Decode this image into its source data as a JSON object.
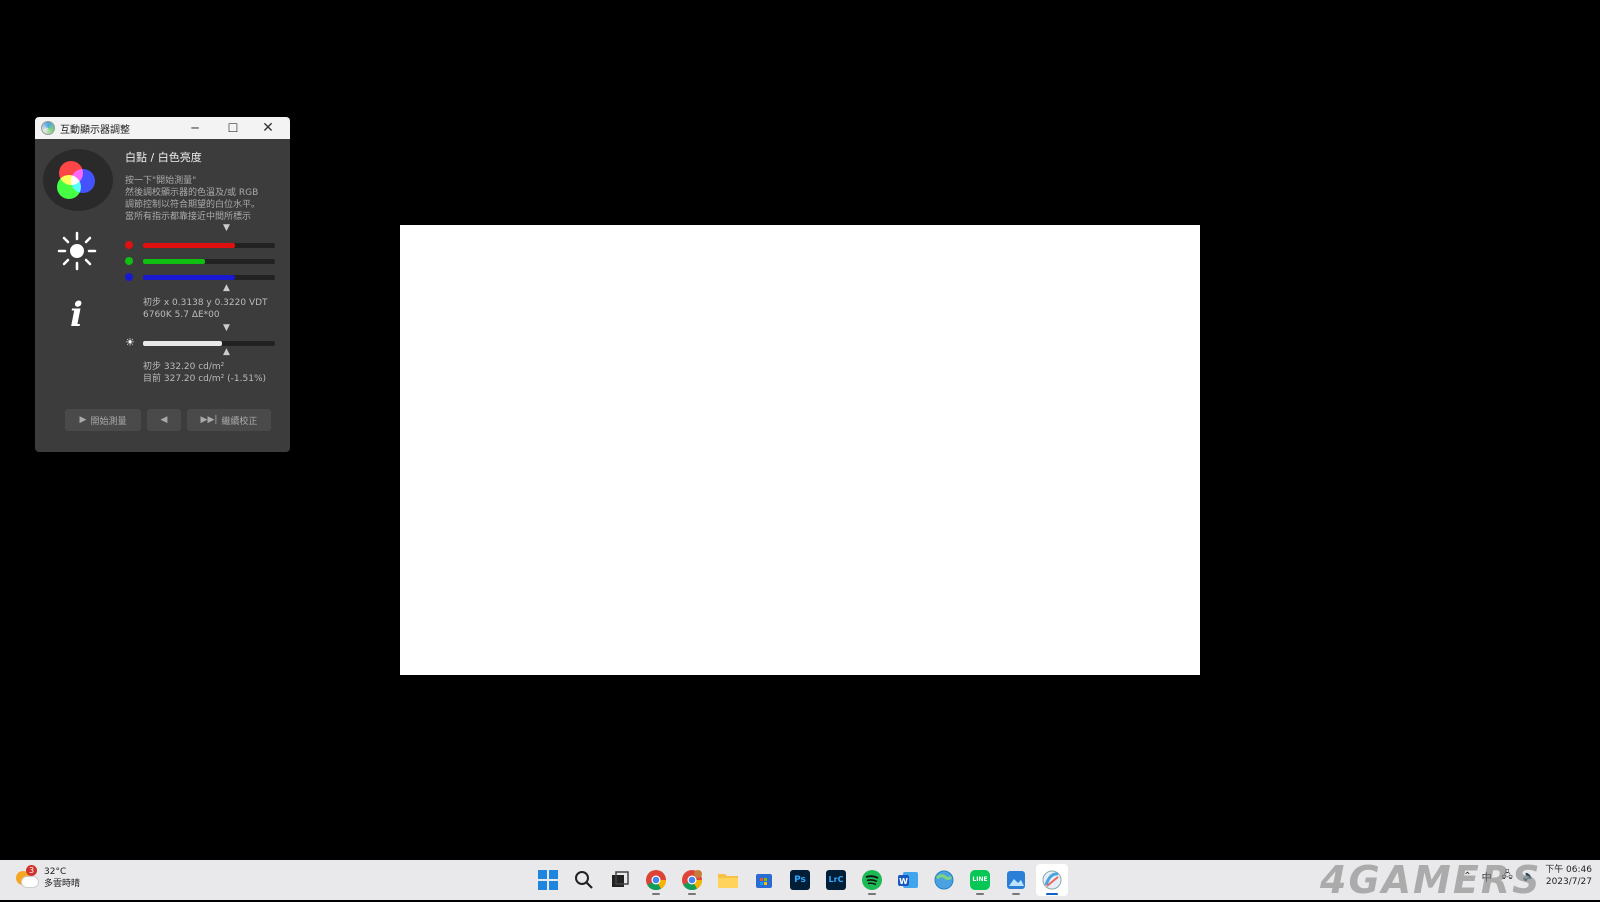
{
  "window": {
    "title": "互動顯示器調整",
    "minimize": "─",
    "maximize": "☐",
    "close": "✕"
  },
  "panel": {
    "section_title": "白點 / 白色亮度",
    "desc_lines": [
      "按一下\"開始測量\"",
      "然後調校顯示器的色溫及/或 RGB",
      "調節控制以符合期望的白位水平。",
      "當所有指示都靠接近中間所標示"
    ],
    "rgb": {
      "red_fill": 0.7,
      "green_fill": 0.47,
      "blue_fill": 0.7,
      "red_color": "#e01010",
      "green_color": "#10c010",
      "blue_color": "#1818d0"
    },
    "chroma_readout_1": "初步 x 0.3138 y 0.3220 VDT",
    "chroma_readout_2": "6760K 5.7 ΔE*00",
    "brightness_fill": 0.6,
    "lum_readout_1": "初步 332.20 cd/m²",
    "lum_readout_2": "目前 327.20 cd/m² (-1.51%)",
    "buttons": {
      "start": "開始測量",
      "back": "",
      "continue": "繼續校正"
    }
  },
  "taskbar": {
    "weather_temp": "32°C",
    "weather_desc": "多雲時晴",
    "weather_badge": "3",
    "apps": [
      "windows-start",
      "search",
      "task-view",
      "chrome",
      "chrome-profile",
      "file-explorer",
      "store",
      "photoshop",
      "lightroom-classic",
      "spotify",
      "word",
      "globe-app",
      "line",
      "photos",
      "displaycal"
    ],
    "tray_ime": "中",
    "clock_time": "下午 06:46",
    "clock_date": "2023/7/27"
  },
  "watermark": "4GAMERS"
}
